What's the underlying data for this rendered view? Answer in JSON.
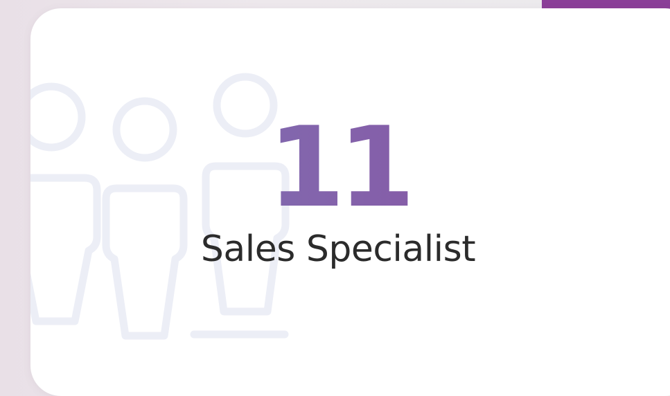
{
  "stat": {
    "number": "11",
    "label": "Sales Specialist"
  },
  "colors": {
    "accent": "#8b3f98",
    "number_gradient_start": "#7c7bb8",
    "number_gradient_end": "#8b4a9e",
    "illustration": "#eceef6",
    "text": "#2b2b2b"
  },
  "icons": [
    "people-group-icon"
  ]
}
